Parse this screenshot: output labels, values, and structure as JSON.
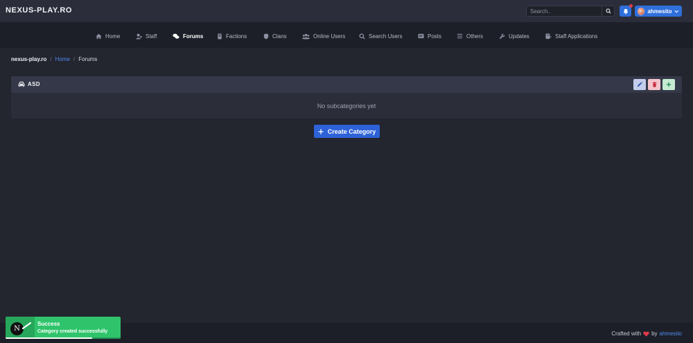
{
  "header": {
    "brand": "NEXUS-PLAY.RO",
    "search": {
      "placeholder": "Search..",
      "value": ""
    },
    "notifications": {
      "has_unread": true
    },
    "user": {
      "name": "ahmesito"
    }
  },
  "nav": {
    "items": [
      {
        "label": "Home",
        "icon": "home-icon",
        "active": false
      },
      {
        "label": "Staff",
        "icon": "staff-icon",
        "active": false
      },
      {
        "label": "Forums",
        "icon": "forums-icon",
        "active": true
      },
      {
        "label": "Factions",
        "icon": "factions-icon",
        "active": false
      },
      {
        "label": "Clans",
        "icon": "shield-icon",
        "active": false
      },
      {
        "label": "Online Users",
        "icon": "users-icon",
        "active": false
      },
      {
        "label": "Search Users",
        "icon": "search-icon",
        "active": false
      },
      {
        "label": "Posts",
        "icon": "posts-icon",
        "active": false
      },
      {
        "label": "Others",
        "icon": "list-icon",
        "active": false
      },
      {
        "label": "Updates",
        "icon": "wrench-icon",
        "active": false
      },
      {
        "label": "Staff Applications",
        "icon": "application-icon",
        "active": false
      }
    ]
  },
  "breadcrumb": {
    "root": "nexus-play.ro",
    "separator": "/",
    "home": "Home",
    "current": "Forums"
  },
  "category": {
    "title": "ASD",
    "icon": "car-icon",
    "empty_text": "No subcategories yet",
    "actions": [
      "edit-icon",
      "trash-icon",
      "plus-icon"
    ]
  },
  "create_button": {
    "label": "Create Category"
  },
  "footer": {
    "crafted": "Crafted with",
    "by": "by",
    "author": "ahmesito"
  },
  "toast": {
    "title": "Success",
    "message": "Category created successfully",
    "progress": 0.75,
    "logo_letter": "N"
  },
  "colors": {
    "accent": "#2f6fdb",
    "success": "#2fc46b",
    "danger": "#e53a4a",
    "background": "#23252f"
  }
}
